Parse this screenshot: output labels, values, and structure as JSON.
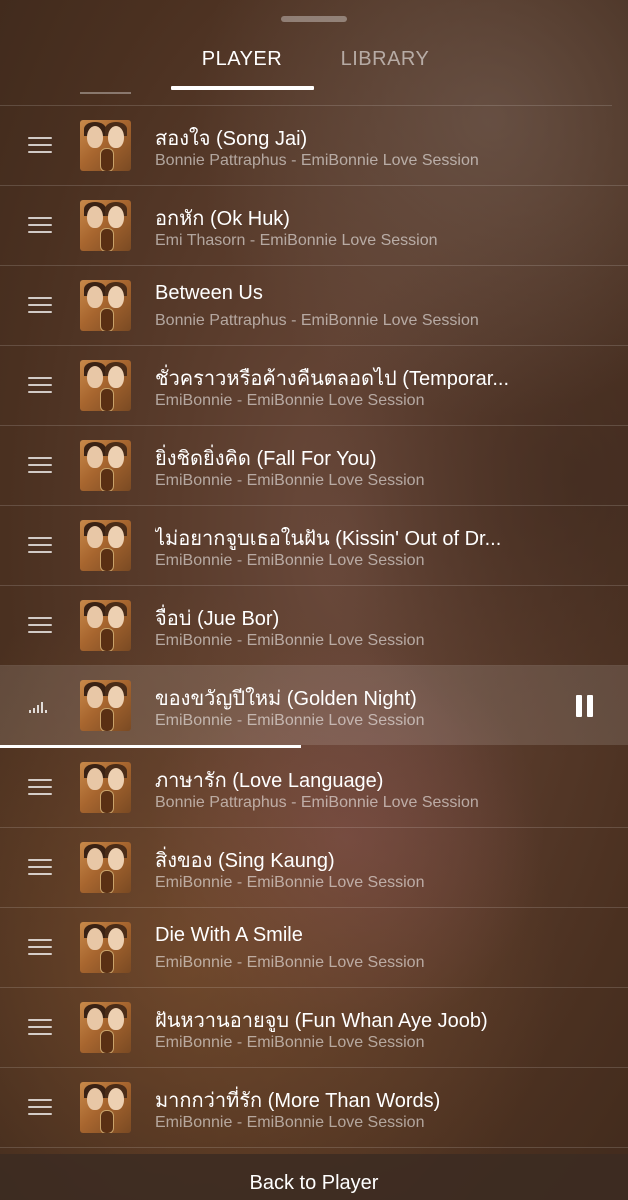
{
  "tabs": {
    "player": "PLAYER",
    "library": "LIBRARY",
    "active": "PLAYER"
  },
  "queue": [
    {
      "title": "สองใจ (Song Jai)",
      "subtitle": "Bonnie Pattraphus - EmiBonnie Love Session"
    },
    {
      "title": "อกหัก (Ok Huk)",
      "subtitle": "Emi Thasorn - EmiBonnie Love Session"
    },
    {
      "title": "Between Us",
      "subtitle": "Bonnie Pattraphus - EmiBonnie Love Session"
    },
    {
      "title": "ชั่วคราวหรือค้างคืนตลอดไป (Temporar...",
      "subtitle": "EmiBonnie - EmiBonnie Love Session"
    },
    {
      "title": "ยิ่งชิดยิ่งคิด (Fall For You)",
      "subtitle": "EmiBonnie - EmiBonnie Love Session"
    },
    {
      "title": "ไม่อยากจูบเธอในฝัน (Kissin' Out of Dr...",
      "subtitle": "EmiBonnie - EmiBonnie Love Session"
    },
    {
      "title": "จื่อบ่ (Jue Bor)",
      "subtitle": "EmiBonnie - EmiBonnie Love Session"
    },
    {
      "title": "ของขวัญปีใหม่ (Golden Night)",
      "subtitle": "EmiBonnie - EmiBonnie Love Session",
      "playing": true,
      "progress": 0.48
    },
    {
      "title": "ภาษารัก (Love Language)",
      "subtitle": "Bonnie Pattraphus - EmiBonnie Love Session"
    },
    {
      "title": "สิ่งของ (Sing Kaung)",
      "subtitle": "EmiBonnie - EmiBonnie Love Session"
    },
    {
      "title": "Die With A Smile",
      "subtitle": "EmiBonnie - EmiBonnie Love Session"
    },
    {
      "title": "ฝันหวานอายจูบ (Fun Whan Aye Joob)",
      "subtitle": "EmiBonnie - EmiBonnie Love Session"
    },
    {
      "title": "มากกว่าที่รัก (More Than Words)",
      "subtitle": "EmiBonnie - EmiBonnie Love Session"
    }
  ],
  "footer": {
    "back_label": "Back to Player"
  },
  "icons": {
    "handle": "drag-handle-icon",
    "now_playing": "equalizer-icon",
    "pause": "pause-icon"
  }
}
